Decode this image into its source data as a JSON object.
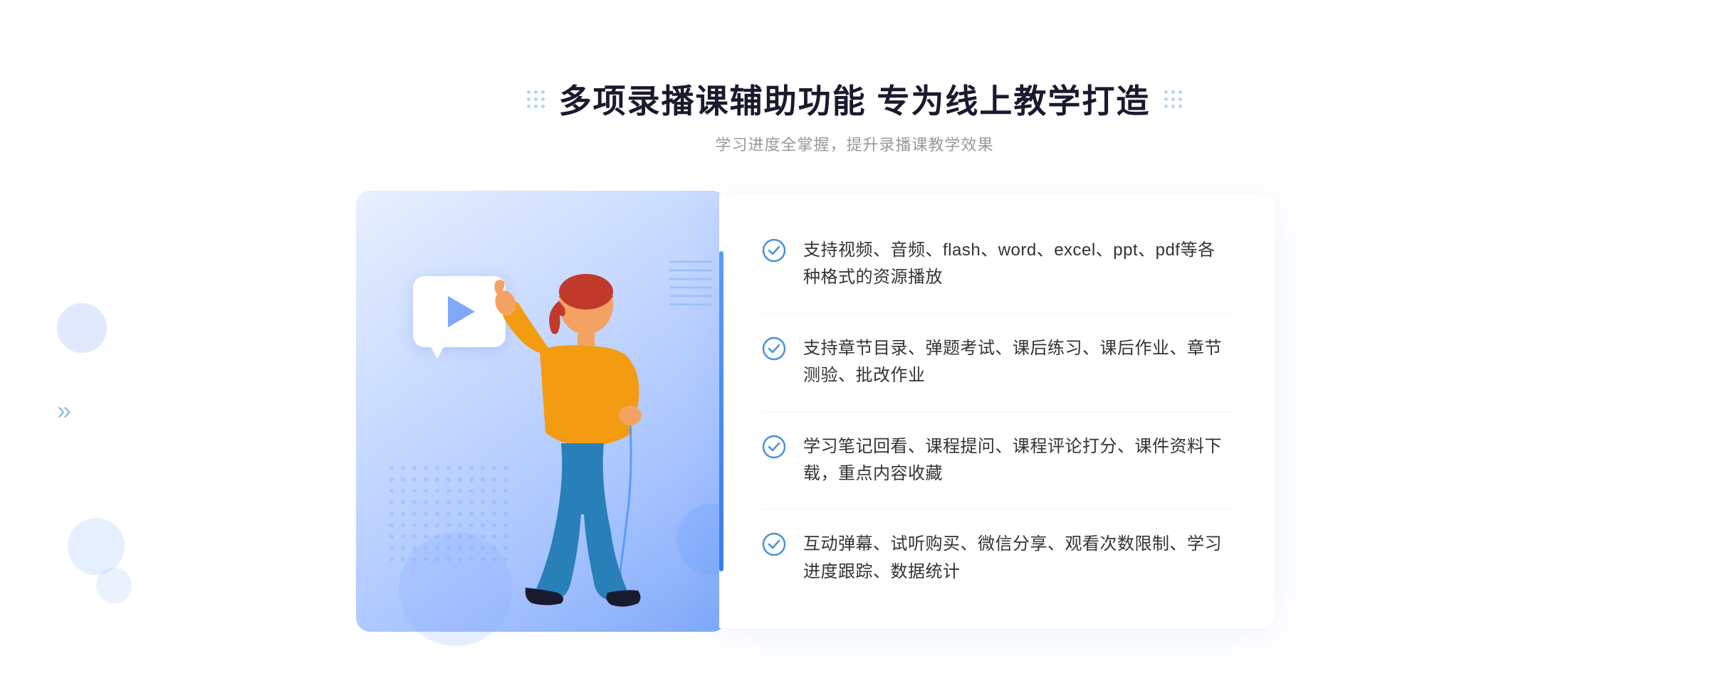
{
  "header": {
    "title": "多项录播课辅助功能 专为线上教学打造",
    "subtitle": "学习进度全掌握，提升录播课教学效果"
  },
  "features": [
    {
      "id": 1,
      "text": "支持视频、音频、flash、word、excel、ppt、pdf等各种格式的资源播放"
    },
    {
      "id": 2,
      "text": "支持章节目录、弹题考试、课后练习、课后作业、章节测验、批改作业"
    },
    {
      "id": 3,
      "text": "学习笔记回看、课程提问、课程评论打分、课件资料下载，重点内容收藏"
    },
    {
      "id": 4,
      "text": "互动弹幕、试听购买、微信分享、观看次数限制、学习进度跟踪、数据统计"
    }
  ],
  "icons": {
    "check": "check-circle-icon",
    "play": "play-icon",
    "chevron": "chevron-right-icon"
  },
  "colors": {
    "primary": "#4a90e2",
    "accent": "#3a7de8",
    "text_dark": "#1a1a2e",
    "text_muted": "#999999",
    "text_body": "#333333"
  }
}
